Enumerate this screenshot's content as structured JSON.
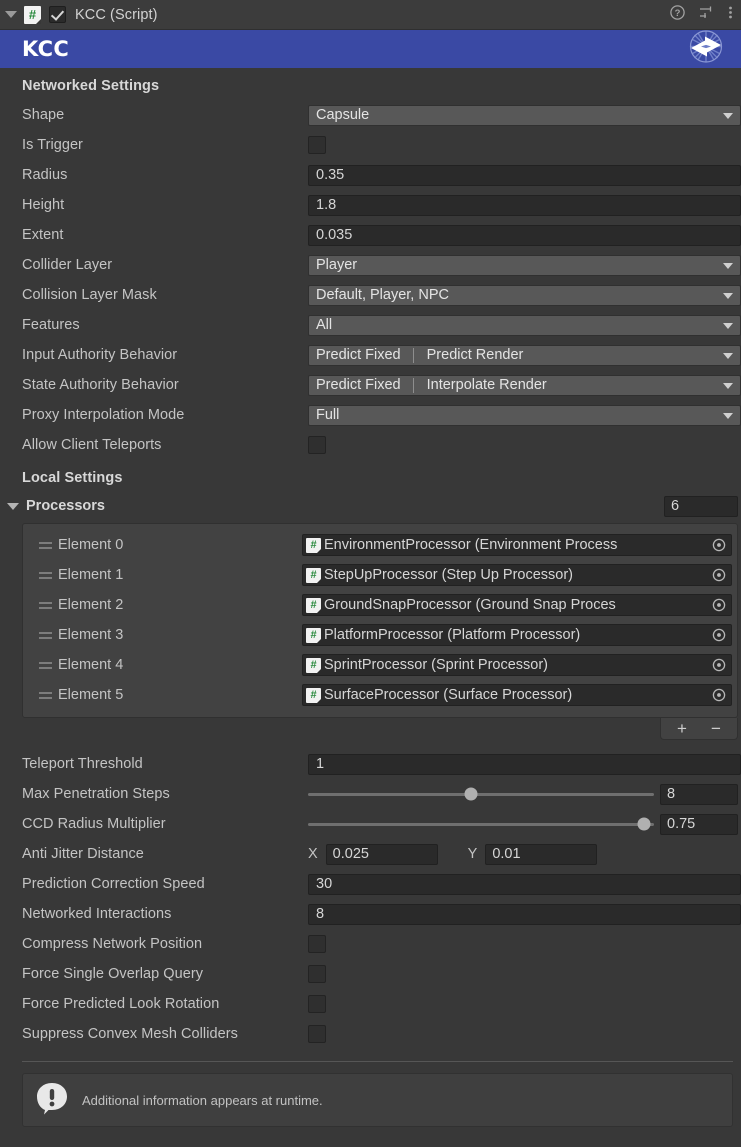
{
  "header": {
    "title": "KCC (Script)",
    "enabled": true,
    "script_icon": "#",
    "icons": [
      "help-icon",
      "preset-icon",
      "more-menu-icon"
    ]
  },
  "banner": {
    "title": "KCC",
    "logo": "exchange-arrows-icon",
    "color": "#3a49a4"
  },
  "networked_settings": {
    "title": "Networked Settings",
    "rows": [
      {
        "label": "Shape",
        "type": "popup",
        "value": "Capsule"
      },
      {
        "label": "Is Trigger",
        "type": "checkbox",
        "value": false
      },
      {
        "label": "Radius",
        "type": "text",
        "value": "0.35"
      },
      {
        "label": "Height",
        "type": "text",
        "value": "1.8"
      },
      {
        "label": "Extent",
        "type": "text",
        "value": "0.035"
      },
      {
        "label": "Collider Layer",
        "type": "popup",
        "value": "Player"
      },
      {
        "label": "Collision Layer Mask",
        "type": "popup",
        "value": "Default, Player, NPC"
      },
      {
        "label": "Features",
        "type": "popup",
        "value": "All"
      },
      {
        "label": "Input Authority Behavior",
        "type": "popup-dual",
        "value": "Predict Fixed",
        "value2": "Predict Render"
      },
      {
        "label": "State Authority Behavior",
        "type": "popup-dual",
        "value": "Predict Fixed",
        "value2": "Interpolate Render"
      },
      {
        "label": "Proxy Interpolation Mode",
        "type": "popup",
        "value": "Full"
      },
      {
        "label": "Allow Client Teleports",
        "type": "checkbox",
        "value": false
      }
    ]
  },
  "local_settings": {
    "title": "Local Settings",
    "processors": {
      "label": "Processors",
      "size": "6",
      "expanded": true,
      "elements": [
        {
          "label": "Element 0",
          "value": "EnvironmentProcessor (Environment Process"
        },
        {
          "label": "Element 1",
          "value": "StepUpProcessor (Step Up Processor)"
        },
        {
          "label": "Element 2",
          "value": "GroundSnapProcessor (Ground Snap Proces"
        },
        {
          "label": "Element 3",
          "value": "PlatformProcessor (Platform Processor)"
        },
        {
          "label": "Element 4",
          "value": "SprintProcessor (Sprint Processor)"
        },
        {
          "label": "Element 5",
          "value": "SurfaceProcessor (Surface Processor)"
        }
      ],
      "add_label": "+",
      "remove_label": "−"
    },
    "rows": [
      {
        "label": "Teleport Threshold",
        "type": "text",
        "value": "1"
      },
      {
        "label": "Max Penetration Steps",
        "type": "slider",
        "value": "8",
        "fill": 47
      },
      {
        "label": "CCD Radius Multiplier",
        "type": "slider",
        "value": "0.75",
        "fill": 97
      },
      {
        "label": "Anti Jitter Distance",
        "type": "vector2",
        "x_label": "X",
        "x_value": "0.025",
        "y_label": "Y",
        "y_value": "0.01"
      },
      {
        "label": "Prediction Correction Speed",
        "type": "text",
        "value": "30"
      },
      {
        "label": "Networked Interactions",
        "type": "text",
        "value": "8"
      },
      {
        "label": "Compress Network Position",
        "type": "checkbox",
        "value": false
      },
      {
        "label": "Force Single Overlap Query",
        "type": "checkbox",
        "value": false
      },
      {
        "label": "Force Predicted Look Rotation",
        "type": "checkbox",
        "value": false
      },
      {
        "label": "Suppress Convex Mesh Colliders",
        "type": "checkbox",
        "value": false
      }
    ]
  },
  "helpbox": {
    "icon": "info-bubble-icon",
    "text": "Additional information appears at runtime."
  }
}
